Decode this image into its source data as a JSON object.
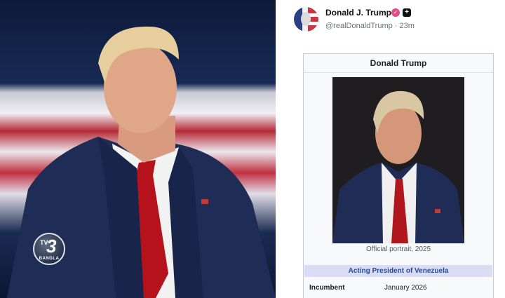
{
  "left_image": {
    "description_icon": "person-photo"
  },
  "watermark": {
    "tv": "TV",
    "num": "3",
    "sub": "BANGLA"
  },
  "post": {
    "author": "Donald J. Trump",
    "handle": "@realDonaldTrump",
    "time": "23m",
    "verified_color": "#e24a8c"
  },
  "infobox": {
    "title": "Donald Trump",
    "caption": "Official portrait, 2025",
    "section": "Acting President of Venezuela",
    "row_label": "Incumbent",
    "row_value": "January 2026"
  }
}
